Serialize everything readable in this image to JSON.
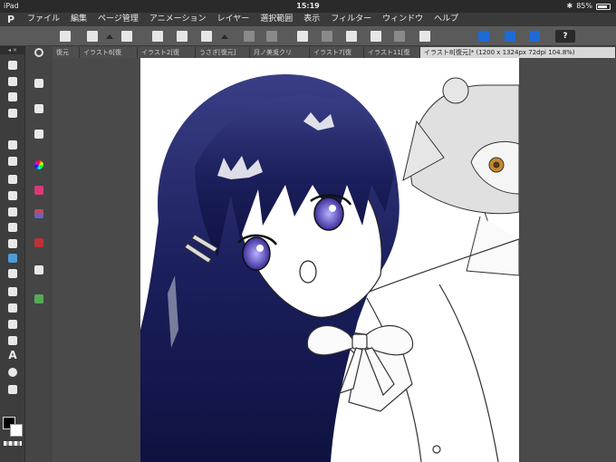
{
  "status": {
    "device": "iPad",
    "time": "15:19",
    "battery_text": "85%",
    "battery_level": 0.85
  },
  "menu": {
    "logo": "P",
    "items": [
      "ファイル",
      "編集",
      "ページ管理",
      "アニメーション",
      "レイヤー",
      "選択範囲",
      "表示",
      "フィルター",
      "ウィンドウ",
      "ヘルプ"
    ]
  },
  "toolbar": {
    "help_label": "?"
  },
  "tabs": [
    {
      "label": "復元"
    },
    {
      "label": "イラスト6[復"
    },
    {
      "label": "イラスト2[復"
    },
    {
      "label": "うさぎ[復元]"
    },
    {
      "label": "月ノ美兎クリ"
    },
    {
      "label": "イラスト7[復"
    },
    {
      "label": "イラスト11[復"
    },
    {
      "label": "イラスト8[復元]* (1200 x 1324px 72dpi 104.8%)"
    }
  ],
  "tools": {
    "text_tool_label": "A"
  },
  "colors": {
    "foreground": "#000000",
    "background": "#ffffff",
    "hair": "#1b1f5c",
    "eye": "#6a6ad8"
  }
}
